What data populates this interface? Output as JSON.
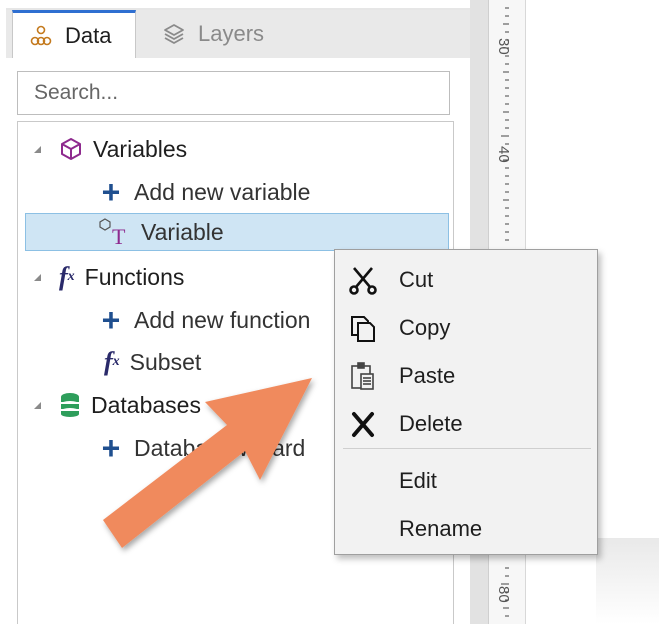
{
  "tabs": [
    {
      "label": "Data",
      "icon": "data-tree-icon",
      "active": true
    },
    {
      "label": "Layers",
      "icon": "layers-icon",
      "active": false
    }
  ],
  "search": {
    "placeholder": "Search..."
  },
  "tree": {
    "variables": {
      "label": "Variables",
      "icon": "cube-icon"
    },
    "add_variable": {
      "label": "Add new variable"
    },
    "variable_item": {
      "label": "Variable"
    },
    "functions": {
      "label": "Functions",
      "icon": "fx-icon"
    },
    "add_function": {
      "label": "Add new function"
    },
    "subset_item": {
      "label": "Subset"
    },
    "databases": {
      "label": "Databases",
      "icon": "database-icon"
    },
    "database_wizard": {
      "label": "Database wizard"
    }
  },
  "ruler": {
    "labels": [
      "30",
      "40",
      "80"
    ]
  },
  "context_menu": {
    "items": [
      {
        "label": "Cut",
        "icon": "scissors-icon"
      },
      {
        "label": "Copy",
        "icon": "copy-icon"
      },
      {
        "label": "Paste",
        "icon": "paste-icon"
      },
      {
        "label": "Delete",
        "icon": "delete-x-icon"
      },
      {
        "label": "Edit",
        "icon": ""
      },
      {
        "label": "Rename",
        "icon": ""
      }
    ]
  },
  "colors": {
    "accent": "#2f6fd1",
    "selection": "#cfe5f4",
    "arrow": "#f08a5d",
    "database": "#2e9e5b",
    "variables_icon": "#8e2a8e"
  }
}
